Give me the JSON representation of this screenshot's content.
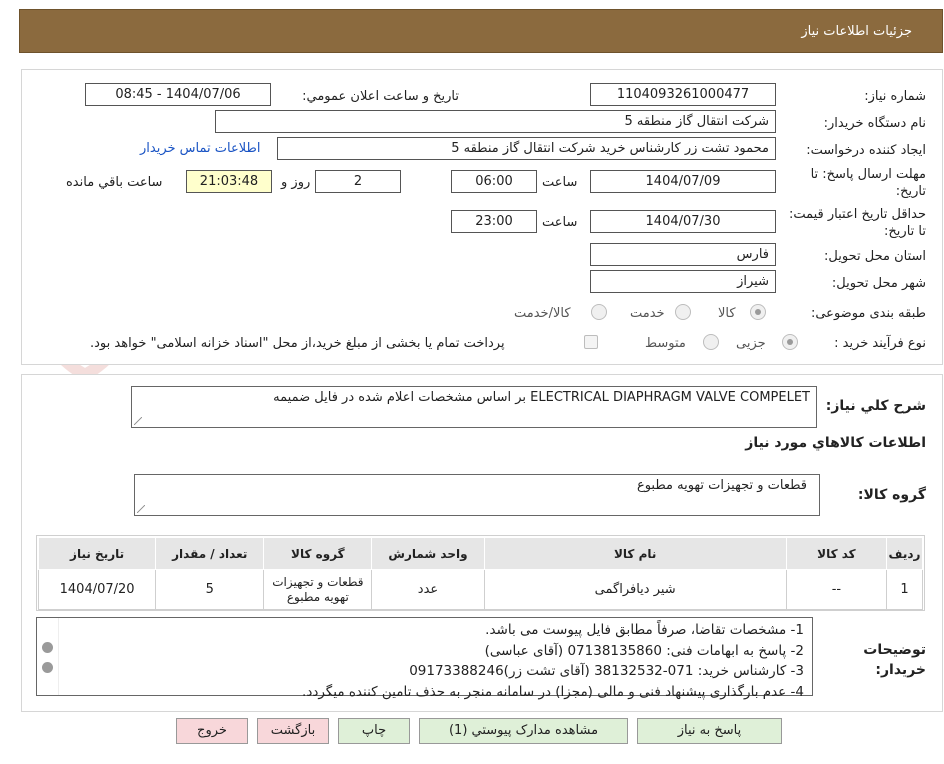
{
  "header": {
    "title": "جزئیات اطلاعات نیاز"
  },
  "fields": {
    "need_number_label": "شماره نیاز:",
    "need_number": "1104093261000477",
    "announce_label": "تاریخ و ساعت اعلان عمومي:",
    "announce_value": "1404/07/06 - 08:45",
    "buyer_org_label": "نام دستگاه خریدار:",
    "buyer_org": "شرکت انتقال گاز منطقه 5",
    "requester_label": "ایجاد کننده درخواست:",
    "requester": "محمود تشت زر کارشناس خرید شرکت انتقال گاز منطقه 5",
    "contact_link": "اطلاعات تماس خریدار",
    "deadline_label": "مهلت ارسال پاسخ: تا تاریخ:",
    "deadline_date": "1404/07/09",
    "time_label": "ساعت",
    "deadline_time": "06:00",
    "days_value": "2",
    "days_label": "روز و",
    "remaining_time": "21:03:48",
    "remaining_label": "ساعت باقي مانده",
    "validity_label": "حداقل تاريخ اعتبار قيمت: تا تاريخ:",
    "validity_date": "1404/07/30",
    "validity_time": "23:00",
    "province_label": "استان محل تحویل:",
    "province": "فارس",
    "city_label": "شهر محل تحویل:",
    "city": "شیراز",
    "category_label": "طبقه بندی موضوعی:",
    "category_options": [
      "کالا",
      "خدمت",
      "کالا/خدمت"
    ],
    "category_selected": "کالا",
    "process_label": "نوع فرآیند خرید :",
    "process_options": [
      "جزیی",
      "متوسط"
    ],
    "process_selected": "جزیی",
    "payment_note": "پرداخت تمام یا بخشی از مبلغ خرید،از محل \"اسناد خزانه اسلامی\" خواهد بود."
  },
  "details": {
    "summary_label": "شرح کلي نياز:",
    "summary": "ELECTRICAL DIAPHRAGM VALVE COMPELET بر اساس مشخصات اعلام شده در فایل ضمیمه",
    "goods_info_title": "اطلاعات کالاهاي مورد نياز",
    "goods_group_label": "گروه کالا:",
    "goods_group": "قطعات و تجهیزات تهویه مطبوع",
    "table": {
      "headers": [
        "رديف",
        "کد کالا",
        "نام کالا",
        "واحد شمارش",
        "گروه کالا",
        "تعداد / مقدار",
        "تاریخ نیاز"
      ],
      "rows": [
        [
          "1",
          "--",
          "شیر دیافراگمی",
          "عدد",
          "قطعات و تجهیزات تهویه مطبوع",
          "5",
          "1404/07/20"
        ]
      ]
    },
    "notes_label": "توضیحات خریدار:",
    "notes": [
      "1-  مشخصات تقاضا، صرفاً مطابق فایل پیوست می باشد.",
      "2- پاسخ به ابهامات فنی: 07138135860 (آقای عباسی)",
      "3- کارشناس خرید: 071-38132532 (آقای تشت زر)09173388246",
      "4- عدم بارگذاری پیشنهاد فنی و مالی (مجزا) در سامانه منجر به حذف تامین کننده میگردد."
    ]
  },
  "buttons": {
    "reply": "پاسخ به نیاز",
    "view_docs": "مشاهده مدارک پیوستي (1)",
    "print": "چاپ",
    "back": "بازگشت",
    "exit": "خروج"
  },
  "colors": {
    "header_bg": "#8b6a3e",
    "reply_btn": "#dff0d8",
    "exit_btn": "#f8d7da",
    "remaining_bg": "#ffffcc"
  }
}
